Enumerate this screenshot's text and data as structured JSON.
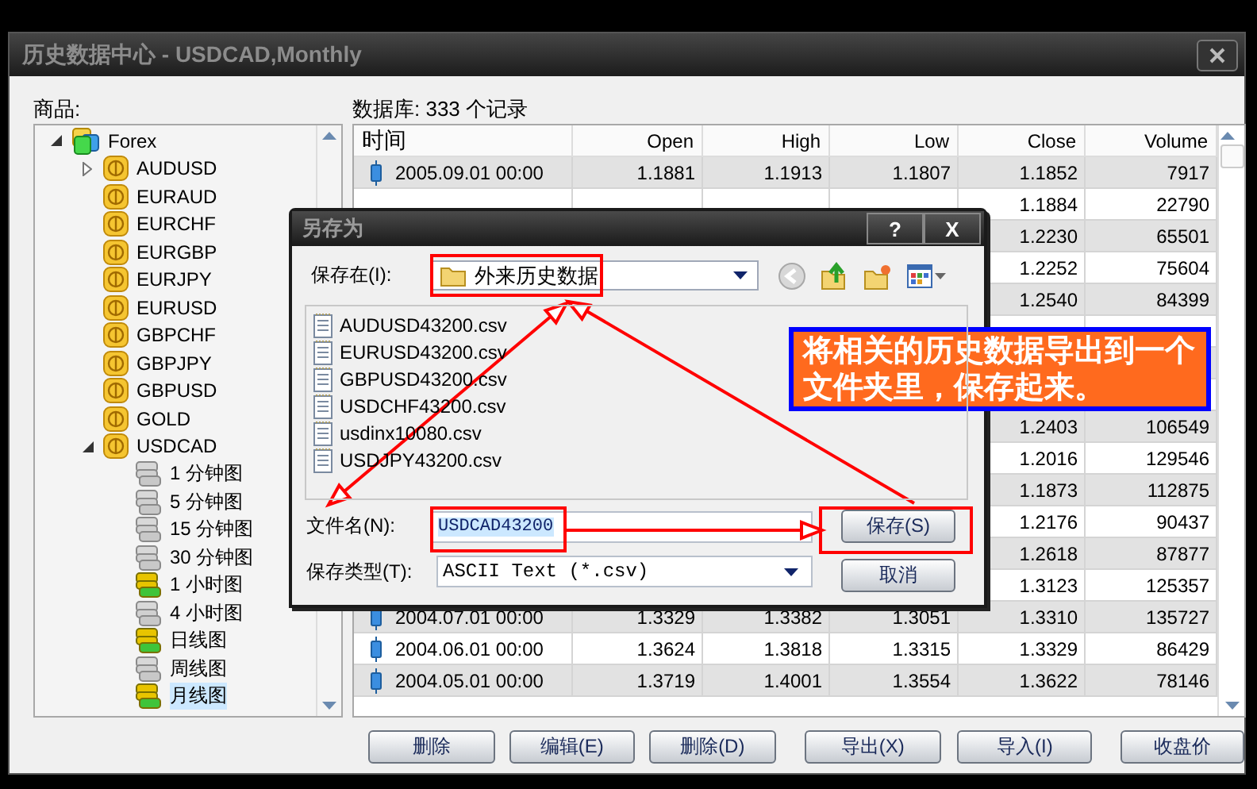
{
  "window": {
    "title": "历史数据中心 - USDCAD,Monthly"
  },
  "symbols": {
    "label": "商品:",
    "tree": [
      {
        "kind": "group",
        "name": "Forex",
        "expanded": true,
        "children": [
          {
            "kind": "symbol",
            "name": "AUDUSD",
            "expanded": false
          },
          {
            "kind": "symbol",
            "name": "EURAUD"
          },
          {
            "kind": "symbol",
            "name": "EURCHF"
          },
          {
            "kind": "symbol",
            "name": "EURGBP"
          },
          {
            "kind": "symbol",
            "name": "EURJPY"
          },
          {
            "kind": "symbol",
            "name": "EURUSD"
          },
          {
            "kind": "symbol",
            "name": "GBPCHF"
          },
          {
            "kind": "symbol",
            "name": "GBPJPY"
          },
          {
            "kind": "symbol",
            "name": "GBPUSD"
          },
          {
            "kind": "symbol",
            "name": "GOLD"
          },
          {
            "kind": "symbol",
            "name": "USDCAD",
            "expanded": true,
            "children": [
              {
                "kind": "period",
                "name": "1 分钟图",
                "has_data": false,
                "selected": false
              },
              {
                "kind": "period",
                "name": "5 分钟图",
                "has_data": false,
                "selected": false
              },
              {
                "kind": "period",
                "name": "15 分钟图",
                "has_data": false,
                "selected": false
              },
              {
                "kind": "period",
                "name": "30 分钟图",
                "has_data": false,
                "selected": false
              },
              {
                "kind": "period",
                "name": "1 小时图",
                "has_data": true,
                "selected": false
              },
              {
                "kind": "period",
                "name": "4 小时图",
                "has_data": false,
                "selected": false
              },
              {
                "kind": "period",
                "name": "日线图",
                "has_data": true,
                "selected": false
              },
              {
                "kind": "period",
                "name": "周线图",
                "has_data": false,
                "selected": false
              },
              {
                "kind": "period",
                "name": "月线图",
                "has_data": true,
                "selected": true
              }
            ]
          }
        ]
      }
    ]
  },
  "database": {
    "label": "数据库: 333 个记录",
    "columns": [
      "时间",
      "Open",
      "High",
      "Low",
      "Close",
      "Volume"
    ],
    "rows": [
      [
        "2005.09.01 00:00",
        "1.1881",
        "1.1913",
        "1.1807",
        "1.1852",
        "7917"
      ],
      [
        null,
        null,
        null,
        null,
        "1.1884",
        "22790"
      ],
      [
        null,
        null,
        null,
        null,
        "1.2230",
        "65501"
      ],
      [
        null,
        null,
        null,
        null,
        "1.2252",
        "75604"
      ],
      [
        null,
        null,
        null,
        null,
        "1.2540",
        "84399"
      ],
      [
        null,
        null,
        null,
        null,
        null,
        null
      ],
      [
        null,
        null,
        null,
        null,
        null,
        null
      ],
      [
        null,
        null,
        null,
        null,
        null,
        null
      ],
      [
        null,
        null,
        null,
        null,
        "1.2403",
        "106549"
      ],
      [
        null,
        null,
        null,
        null,
        "1.2016",
        "129546"
      ],
      [
        null,
        null,
        null,
        null,
        "1.1873",
        "112875"
      ],
      [
        null,
        null,
        null,
        null,
        "1.2176",
        "90437"
      ],
      [
        null,
        null,
        null,
        null,
        "1.2618",
        "87877"
      ],
      [
        null,
        null,
        null,
        null,
        "1.3123",
        "125357"
      ],
      [
        "2004.07.01 00:00",
        "1.3329",
        "1.3382",
        "1.3051",
        "1.3310",
        "135727"
      ],
      [
        "2004.06.01 00:00",
        "1.3624",
        "1.3818",
        "1.3315",
        "1.3329",
        "86429"
      ],
      [
        "2004.05.01 00:00",
        "1.3719",
        "1.4001",
        "1.3554",
        "1.3622",
        "78146"
      ]
    ]
  },
  "buttons": [
    "删除",
    "编辑(E)",
    "删除(D)",
    "导出(X)",
    "导入(I)",
    "收盘价"
  ],
  "save_dialog": {
    "title": "另存为",
    "help": "?",
    "close": "X",
    "save_in": {
      "label": "保存在(I):",
      "value": "外来历史数据"
    },
    "files": [
      "AUDUSD43200.csv",
      "EURUSD43200.csv",
      "GBPUSD43200.csv",
      "USDCHF43200.csv",
      "usdinx10080.csv",
      "USDJPY43200.csv"
    ],
    "file_name": {
      "label": "文件名(N):",
      "value": "USDCAD43200"
    },
    "file_type": {
      "label": "保存类型(T):",
      "value": "ASCII Text (*.csv)"
    },
    "buttons": [
      "保存(S)",
      "取消"
    ]
  },
  "callout": {
    "text": "将相关的历史数据导出到一个文件夹里，保存起来。"
  }
}
